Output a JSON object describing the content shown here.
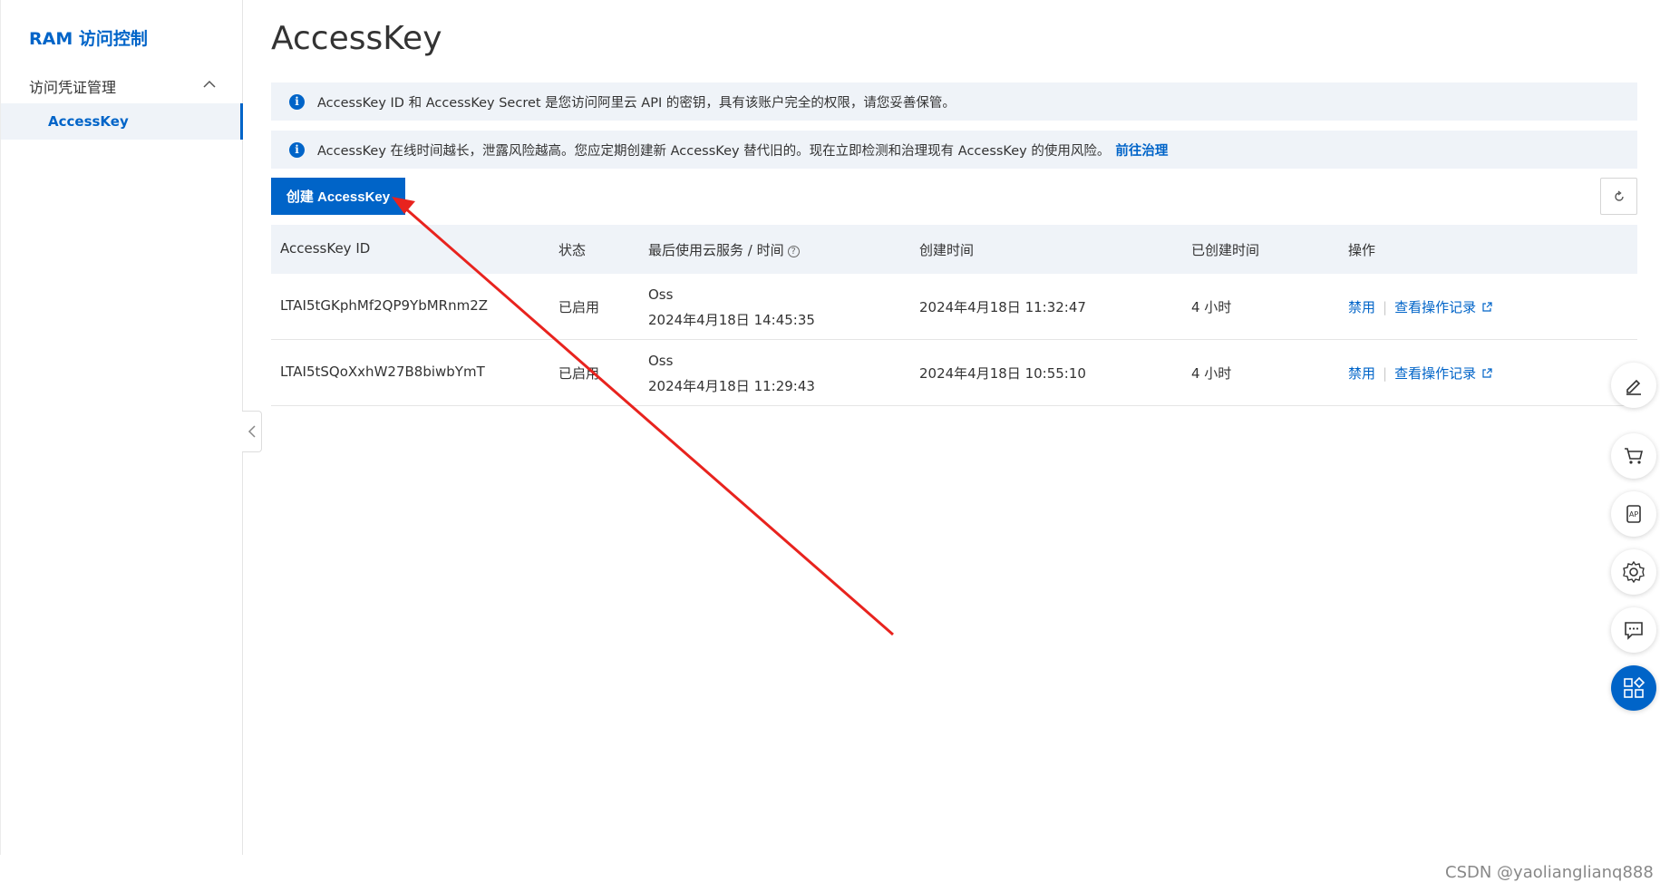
{
  "sidebar": {
    "brand": "RAM 访问控制",
    "group_label": "访问凭证管理",
    "active_item": "AccessKey"
  },
  "page": {
    "title": "AccessKey"
  },
  "alerts": {
    "first": "AccessKey ID 和 AccessKey Secret 是您访问阿里云 API 的密钥，具有该账户完全的权限，请您妥善保管。",
    "second": "AccessKey 在线时间越长，泄露风险越高。您应定期创建新 AccessKey 替代旧的。现在立即检测和治理现有 AccessKey 的使用风险。",
    "second_link": "前往治理"
  },
  "toolbar": {
    "create_label": "创建 AccessKey"
  },
  "table": {
    "headers": {
      "id": "AccessKey ID",
      "status": "状态",
      "last_used": "最后使用云服务 / 时间",
      "created": "创建时间",
      "age": "已创建时间",
      "actions": "操作"
    },
    "rows": [
      {
        "id": "LTAI5tGKphMf2QP9YbMRnm2Z",
        "status": "已启用",
        "service": "Oss",
        "last_time": "2024年4月18日 14:45:35",
        "created": "2024年4月18日 11:32:47",
        "age": "4 小时",
        "action_disable": "禁用",
        "action_log": "查看操作记录"
      },
      {
        "id": "LTAI5tSQoXxhW27B8biwbYmT",
        "status": "已启用",
        "service": "Oss",
        "last_time": "2024年4月18日 11:29:43",
        "created": "2024年4月18日 10:55:10",
        "age": "4 小时",
        "action_disable": "禁用",
        "action_log": "查看操作记录"
      }
    ]
  },
  "float_toolbar": [
    "edit-icon",
    "cart-icon",
    "api-icon",
    "settings-icon",
    "feedback-icon",
    "apps-icon"
  ],
  "colors": {
    "brand": "#0064c8",
    "annotation_arrow": "#e8231e"
  },
  "watermark": "CSDN @yaolianglianq888"
}
